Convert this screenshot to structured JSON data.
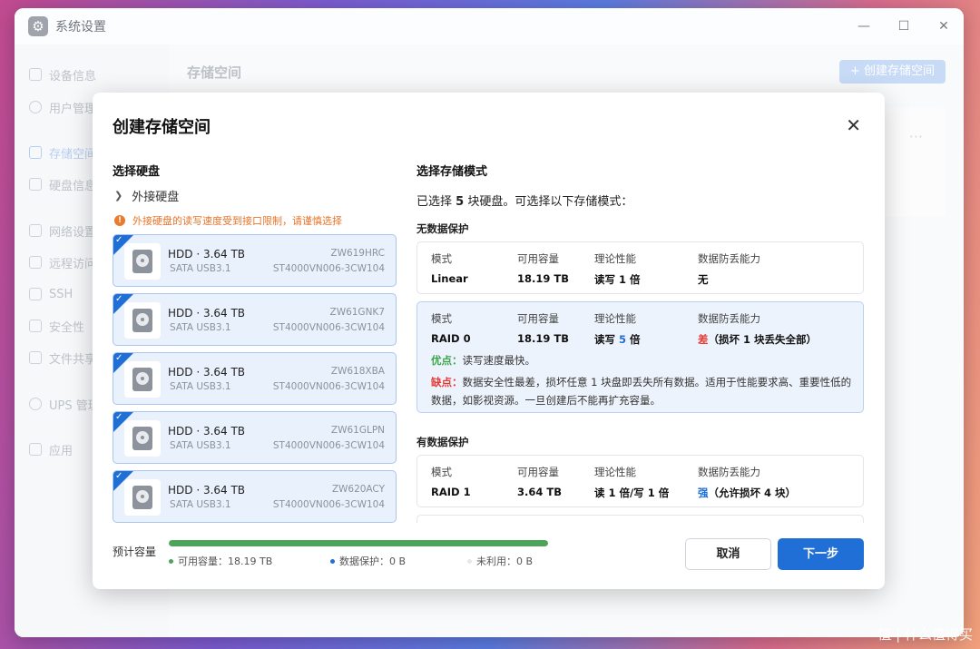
{
  "window": {
    "title": "系统设置",
    "icon": "gear-icon",
    "controls": {
      "minimize": "—",
      "maximize": "☐",
      "close": "✕"
    }
  },
  "sidebar": {
    "items": [
      {
        "label": "设备信息",
        "icon": "device-icon"
      },
      {
        "label": "用户管理",
        "icon": "user-icon"
      },
      {
        "label": "存储空间",
        "icon": "storage-icon",
        "active": true
      },
      {
        "label": "硬盘信息",
        "icon": "disk-icon"
      },
      {
        "label": "网络设置",
        "icon": "network-icon"
      },
      {
        "label": "远程访问",
        "icon": "send-icon"
      },
      {
        "label": "SSH",
        "icon": "terminal-icon"
      },
      {
        "label": "安全性",
        "icon": "shield-icon"
      },
      {
        "label": "文件共享",
        "icon": "file-icon"
      },
      {
        "label": "UPS 管理",
        "icon": "ups-icon"
      },
      {
        "label": "应用",
        "icon": "apps-icon"
      }
    ]
  },
  "main": {
    "title": "存储空间",
    "create_button": "+ 创建存储空间",
    "more": "···"
  },
  "modal": {
    "title": "创建存储空间",
    "close": "✕",
    "disks_section": {
      "title": "选择硬盘",
      "group": "外接硬盘",
      "warning": "外接硬盘的读写速度受到接口限制，请谨慎选择",
      "disks": [
        {
          "name": "HDD · 3.64 TB",
          "iface": "SATA USB3.1",
          "serial": "ZW619HRC",
          "model": "ST4000VN006-3CW104",
          "checked": true
        },
        {
          "name": "HDD · 3.64 TB",
          "iface": "SATA USB3.1",
          "serial": "ZW61GNK7",
          "model": "ST4000VN006-3CW104",
          "checked": true
        },
        {
          "name": "HDD · 3.64 TB",
          "iface": "SATA USB3.1",
          "serial": "ZW618XBA",
          "model": "ST4000VN006-3CW104",
          "checked": true
        },
        {
          "name": "HDD · 3.64 TB",
          "iface": "SATA USB3.1",
          "serial": "ZW61GLPN",
          "model": "ST4000VN006-3CW104",
          "checked": true
        },
        {
          "name": "HDD · 3.64 TB",
          "iface": "SATA USB3.1",
          "serial": "ZW620ACY",
          "model": "ST4000VN006-3CW104",
          "checked": true
        }
      ]
    },
    "modes_section": {
      "title": "选择存储模式",
      "selected_prefix": "已选择 ",
      "selected_count": "5",
      "selected_suffix": " 块硬盘。可选择以下存储模式：",
      "headers": {
        "mode": "模式",
        "capacity": "可用容量",
        "performance": "理论性能",
        "protection": "数据防丢能力"
      },
      "no_protection_label": "无数据保护",
      "with_protection_label": "有数据保护",
      "linear": {
        "mode": "Linear",
        "capacity": "18.19 TB",
        "performance": "读写 1 倍",
        "protection": "无"
      },
      "raid0": {
        "mode": "RAID 0",
        "capacity": "18.19 TB",
        "perf_prefix": "读写 ",
        "perf_value": "5",
        "perf_suffix": " 倍",
        "prot_level": "差",
        "prot_detail": "（损坏 1 块丢失全部）",
        "pros_tag": "优点：",
        "pros_text": "读写速度最快。",
        "cons_tag": "缺点：",
        "cons_text": "数据安全性最差，损坏任意 1 块盘即丢失所有数据。适用于性能要求高、重要性低的数据，如影视资源。一旦创建后不能再扩充容量。"
      },
      "raid1": {
        "mode": "RAID 1",
        "capacity": "3.64 TB",
        "performance": "读 1 倍/写 1 倍",
        "prot_level": "强",
        "prot_detail": "（允许损坏 4 块）"
      }
    },
    "footer": {
      "capacity_label": "预计容量",
      "progress_available_fraction": 1.0,
      "legend_available": "可用容量：18.19 TB",
      "legend_protection": "数据保护：0 B",
      "legend_unused": "未利用：0 B",
      "colors": {
        "available": "#4ea45a",
        "protection": "#1f6fd6",
        "unused": "#e5e7eb"
      },
      "cancel": "取消",
      "next": "下一步"
    }
  },
  "watermark": "值 | 什么值得买"
}
